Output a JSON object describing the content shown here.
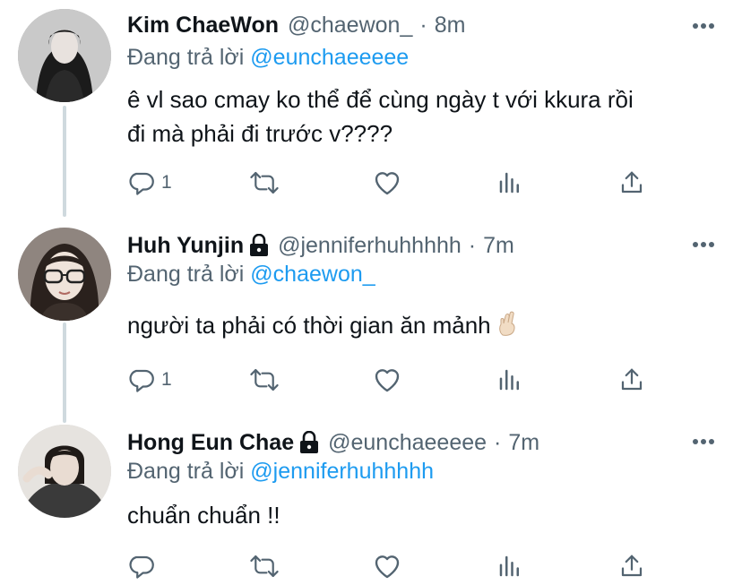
{
  "replying_prefix": "Đang trả lời",
  "colors": {
    "accent": "#1d9bf0",
    "muted": "#536471",
    "text": "#0f1419",
    "thread_line": "#cfd9de"
  },
  "tweets": [
    {
      "name": "Kim ChaeWon",
      "locked": false,
      "handle": "@chaewon_",
      "time": "8m",
      "replying_to": "@eunchaeeeee",
      "text_lines": [
        "ê vl sao cmay ko thể để cùng ngày t với kkura rồi",
        "đi mà phải đi trước v????"
      ],
      "reply_count": "1"
    },
    {
      "name": "Huh Yunjin",
      "locked": true,
      "handle": "@jenniferhuhhhhh",
      "time": "7m",
      "replying_to": "@chaewon_",
      "text_lines": [
        "người ta phải có thời gian ăn mảnh"
      ],
      "emoji": "crossed-fingers",
      "reply_count": "1"
    },
    {
      "name": "Hong Eun Chae",
      "locked": true,
      "handle": "@eunchaeeeee",
      "time": "7m",
      "replying_to": "@jenniferhuhhhhh",
      "text_lines": [
        "chuẩn chuẩn !!"
      ],
      "reply_count": ""
    }
  ],
  "icons": [
    "reply-icon",
    "retweet-icon",
    "like-icon",
    "analytics-icon",
    "share-icon",
    "more-icon",
    "lock-icon"
  ]
}
